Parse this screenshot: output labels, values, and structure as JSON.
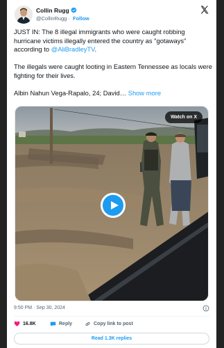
{
  "author": {
    "name": "Collin Rugg",
    "handle": "@CollinRugg",
    "follow_label": "Follow",
    "verified_color": "#1d9bf0"
  },
  "logo": "x-logo",
  "tweet": {
    "p1_before": "JUST IN: The 8 illegal immigrants who were caught robbing hurricane victims illegally entered the country as \"gotaways\" according to ",
    "p1_mention": "@AliBradleyTV",
    "p1_after": ".",
    "p2": "The illegals were caught looting in Eastern Tennessee as locals were fighting for their lives.",
    "p3": "Albin Nahun Vega-Rapalo, 24; David… ",
    "show_more": "Show more"
  },
  "media": {
    "watch_label": "Watch on X",
    "play_icon": "play-icon"
  },
  "meta": {
    "timestamp": "9:50 PM · Sep 30, 2024"
  },
  "actions": {
    "likes": "16.8K",
    "reply_label": "Reply",
    "copy_label": "Copy link to post"
  },
  "read_replies_label": "Read 1.3K replies",
  "colors": {
    "accent": "#1d9bf0",
    "like": "#f91880",
    "text": "#0f1419",
    "muted": "#536471"
  }
}
